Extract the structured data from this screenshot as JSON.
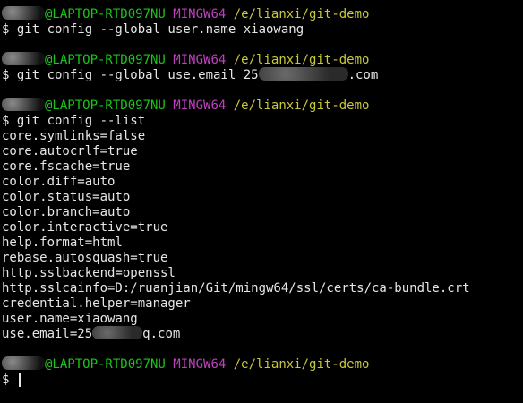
{
  "terminal": {
    "prompts": [
      {
        "user": "@LAPTOP-RTD097NU",
        "shell": "MINGW64",
        "path": "/e/lianxi/git-demo"
      },
      {
        "user": "@LAPTOP-RTD097NU",
        "shell": "MINGW64",
        "path": "/e/lianxi/git-demo"
      },
      {
        "user": "@LAPTOP-RTD097NU",
        "shell": "MINGW64",
        "path": "/e/lianxi/git-demo"
      },
      {
        "user": "@LAPTOP-RTD097NU",
        "shell": "MINGW64",
        "path": "/e/lianxi/git-demo"
      }
    ],
    "commands": [
      "$ git config --global user.name xiaowang",
      "$ git config --global use.email 25",
      "$ git config --list",
      "$ "
    ],
    "email_cmd_tail": ".com",
    "output": [
      "core.symlinks=false",
      "core.autocrlf=true",
      "core.fscache=true",
      "color.diff=auto",
      "color.status=auto",
      "color.branch=auto",
      "color.interactive=true",
      "help.format=html",
      "rebase.autosquash=true",
      "http.sslbackend=openssl",
      "http.sslcainfo=D:/ruanjian/Git/mingw64/ssl/certs/ca-bundle.crt",
      "credential.helper=manager",
      "user.name=xiaowang"
    ],
    "email_line_prefix": "use.email=25",
    "email_line_suffix": "q.com",
    "colors": {
      "userhost": "#19c519",
      "shell": "#c040c0",
      "path": "#c8c83a",
      "text": "#e6e6e6",
      "background": "#000000"
    }
  }
}
